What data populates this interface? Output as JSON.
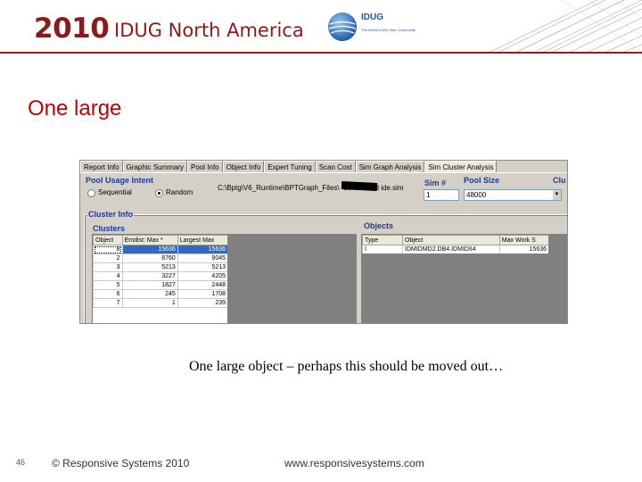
{
  "header": {
    "year": "2010",
    "conference": "IDUG North America",
    "logo_text": "IDUG",
    "logo_tagline": "The World's DB2 User Community",
    "accent_color": "#8b1a1a",
    "line_color": "#9a1b1b"
  },
  "slide_title": "One large",
  "app": {
    "tabs": [
      "Report Info",
      "Graphic Summary",
      "Pool Info",
      "Object Info",
      "Expert Tuning",
      "Scan Cost",
      "Sim Graph Analysis",
      "Sim Cluster Analysis"
    ],
    "active_tab": "Sim Cluster Analysis",
    "pool_usage": {
      "label": "Pool Usage Intent",
      "options": [
        "Sequential",
        "Random"
      ],
      "selected": "Random"
    },
    "file_path": "C:\\Bptg\\V6_Runtime\\BPTGraph_Files\\           -b3-vs2 and ide.sim",
    "sim_label": "Sim #",
    "sim_value": "1",
    "pool_size_label": "Pool Size",
    "pool_size_value": "48000",
    "truncated_label": "Clu",
    "cluster_info_label": "Cluster Info",
    "clusters": {
      "label": "Clusters",
      "columns": [
        "Object",
        "Emdist: Max *",
        "Largest Max"
      ],
      "rows": [
        [
          "8",
          "15636",
          "15636"
        ],
        [
          "2",
          "8760",
          "9045"
        ],
        [
          "3",
          "5213",
          "5213"
        ],
        [
          "4",
          "3227",
          "4205"
        ],
        [
          "5",
          "1827",
          "2448"
        ],
        [
          "6",
          "245",
          "1708"
        ],
        [
          "7",
          "1",
          "239"
        ]
      ],
      "selected_row": 0
    },
    "objects": {
      "label": "Objects",
      "columns": [
        "Type",
        "Object",
        "Max Work S"
      ],
      "rows": [
        [
          "I",
          "IDMIDMD2.DB4.IDMIDII4",
          "15636"
        ]
      ]
    }
  },
  "caption": "One large object – perhaps this should be moved out…",
  "footer": {
    "page_number": "46",
    "copyright": "© Responsive Systems 2010",
    "website": "www.responsivesystems.com"
  }
}
